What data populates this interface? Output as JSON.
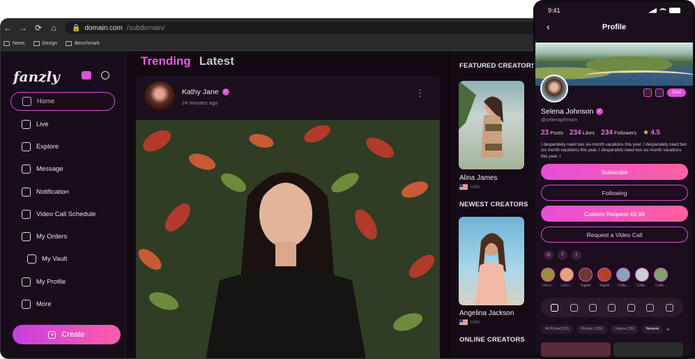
{
  "browser": {
    "url_domain": "domain.com",
    "url_path": "/subdomain/",
    "bookmarks": [
      "News",
      "Design",
      "Benchmark"
    ]
  },
  "app": {
    "logo": "fanzly",
    "menu": [
      "Home",
      "Live",
      "Explore",
      "Message",
      "Notification",
      "Video Call Schedule",
      "My Orders",
      "My Vault",
      "My Profile",
      "More"
    ],
    "create_label": "Create"
  },
  "feed": {
    "tab_trending": "Trending",
    "tab_latest": "Latest",
    "post": {
      "author": "Kathy Jane",
      "time": "24 minutes ago"
    }
  },
  "creators": {
    "featured_title": "FEATURED CREATORS",
    "newest_title": "NEWEST CREATORS",
    "online_title": "ONLINE CREATORS",
    "featured": {
      "name": "Alina James",
      "loc": "USA"
    },
    "newest": {
      "name": "Angelina Jackson",
      "loc": "USA"
    }
  },
  "phone": {
    "time": "9:41",
    "title": "Profile",
    "chat": "Chat",
    "name": "Selena Johnson",
    "handle": "@selenajohnson",
    "posts_n": "23",
    "posts_l": "Posts",
    "likes_n": "234",
    "likes_l": "Likes",
    "followers_n": "234",
    "followers_l": "Followers",
    "rating": "4.5",
    "bio": "I desperately need two six-month vacations this year. I desperately need two six-month vacations this year. I desperately need two six-month vacations this year. I",
    "subscribe": "Subscribe",
    "following": "Following",
    "custom": "Custom Request 49.99",
    "videocall": "Request a Video Call",
    "stories": [
      "Let's t...",
      "Let's t...",
      "Togeth",
      "Togeth",
      "Coffe...",
      "Coffe...",
      "Coffe..."
    ],
    "filters": [
      "All Posts(153)",
      "Photos (135)",
      "Videos (20)",
      "Newest"
    ]
  },
  "colors": {
    "accent": "#e14ede",
    "bg": "#160a17"
  }
}
